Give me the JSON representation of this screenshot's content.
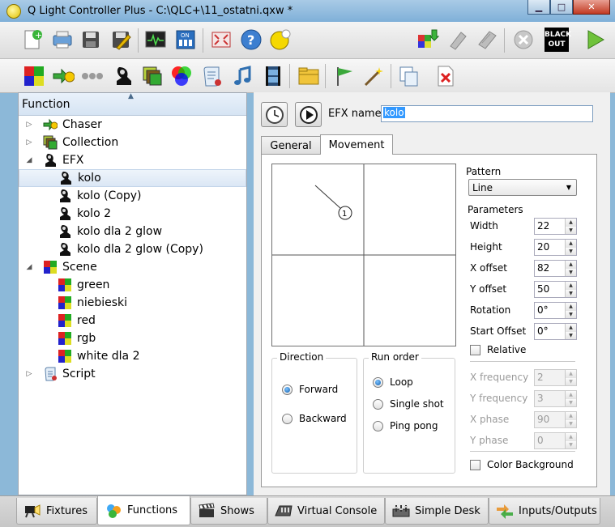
{
  "window": {
    "title": "Q Light Controller Plus - C:\\QLC+\\11_ostatni.qxw *",
    "min_glyph": "▁",
    "max_glyph": "□",
    "close_glyph": "✕"
  },
  "toolbar_main": {
    "icons": [
      "new-file-icon",
      "open-icon",
      "save-icon",
      "save-as-icon",
      "monitor-icon",
      "address-tool-icon",
      "fullscreen-icon",
      "help-icon",
      "about-icon",
      "live-edit-icon",
      "stop-all-icon",
      "disable-icon",
      "remove-icon",
      "blackout-icon",
      "play-icon"
    ],
    "blackout_label": "BLACK OUT"
  },
  "toolbar_functions": {
    "icons": [
      "new-scene-icon",
      "new-chaser-icon",
      "new-sequence-icon",
      "new-efx-icon",
      "new-collection-icon",
      "new-rgb-matrix-icon",
      "new-script-icon",
      "new-audio-icon",
      "new-video-icon",
      "new-folder-icon",
      "wizard-flag-icon",
      "wizard-wand-icon",
      "clone-icon",
      "delete-icon"
    ]
  },
  "tree": {
    "header": "Function",
    "items": [
      {
        "label": "Chaser",
        "level": 0,
        "arrow": "▷",
        "icon": "chaser-icon"
      },
      {
        "label": "Collection",
        "level": 0,
        "arrow": "▷",
        "icon": "collection-icon"
      },
      {
        "label": "EFX",
        "level": 0,
        "arrow": "◢",
        "icon": "efx-icon"
      },
      {
        "label": "kolo",
        "level": 1,
        "selected": true,
        "icon": "efx-icon"
      },
      {
        "label": "kolo (Copy)",
        "level": 1,
        "icon": "efx-icon"
      },
      {
        "label": "kolo 2",
        "level": 1,
        "icon": "efx-icon"
      },
      {
        "label": "kolo dla 2 glow",
        "level": 1,
        "icon": "efx-icon"
      },
      {
        "label": "kolo dla 2 glow (Copy)",
        "level": 1,
        "icon": "efx-icon"
      },
      {
        "label": "Scene",
        "level": 0,
        "arrow": "◢",
        "icon": "scene-icon"
      },
      {
        "label": "green",
        "level": 1,
        "icon": "scene-icon"
      },
      {
        "label": "niebieski",
        "level": 1,
        "icon": "scene-icon"
      },
      {
        "label": "red",
        "level": 1,
        "icon": "scene-icon"
      },
      {
        "label": "rgb",
        "level": 1,
        "icon": "scene-icon"
      },
      {
        "label": "white dla 2",
        "level": 1,
        "icon": "scene-icon"
      },
      {
        "label": "Script",
        "level": 0,
        "arrow": "▷",
        "icon": "script-icon"
      }
    ]
  },
  "editor": {
    "efx_name_label": "EFX name",
    "efx_name_value": "kolo",
    "tabs": [
      "General",
      "Movement"
    ],
    "active_tab": "Movement",
    "preview": {
      "fixture_label": "1"
    },
    "direction": {
      "title": "Direction",
      "options": [
        {
          "label": "Forward",
          "checked": true
        },
        {
          "label": "Backward",
          "checked": false
        }
      ]
    },
    "run_order": {
      "title": "Run order",
      "options": [
        {
          "label": "Loop",
          "checked": true
        },
        {
          "label": "Single shot",
          "checked": false
        },
        {
          "label": "Ping pong",
          "checked": false
        }
      ]
    },
    "pattern": {
      "title": "Pattern",
      "value": "Line"
    },
    "parameters": {
      "title": "Parameters",
      "rows": [
        {
          "label": "Width",
          "value": "22",
          "enabled": true
        },
        {
          "label": "Height",
          "value": "20",
          "enabled": true
        },
        {
          "label": "X offset",
          "value": "82",
          "enabled": true
        },
        {
          "label": "Y offset",
          "value": "50",
          "enabled": true
        },
        {
          "label": "Rotation",
          "value": "0°",
          "enabled": true
        },
        {
          "label": "Start Offset",
          "value": "0°",
          "enabled": true
        }
      ],
      "relative_label": "Relative",
      "freq_rows": [
        {
          "label": "X frequency",
          "value": "2",
          "enabled": false
        },
        {
          "label": "Y frequency",
          "value": "3",
          "enabled": false
        },
        {
          "label": "X phase",
          "value": "90",
          "enabled": false
        },
        {
          "label": "Y phase",
          "value": "0",
          "enabled": false
        }
      ],
      "color_bg_label": "Color Background"
    }
  },
  "bottom_tabs": [
    {
      "label": "Fixtures",
      "icon": "fixtures-icon"
    },
    {
      "label": "Functions",
      "icon": "functions-icon",
      "active": true
    },
    {
      "label": "Shows",
      "icon": "shows-icon"
    },
    {
      "label": "Virtual Console",
      "icon": "virtual-console-icon"
    },
    {
      "label": "Simple Desk",
      "icon": "simple-desk-icon"
    },
    {
      "label": "Inputs/Outputs",
      "icon": "inputs-outputs-icon"
    }
  ]
}
